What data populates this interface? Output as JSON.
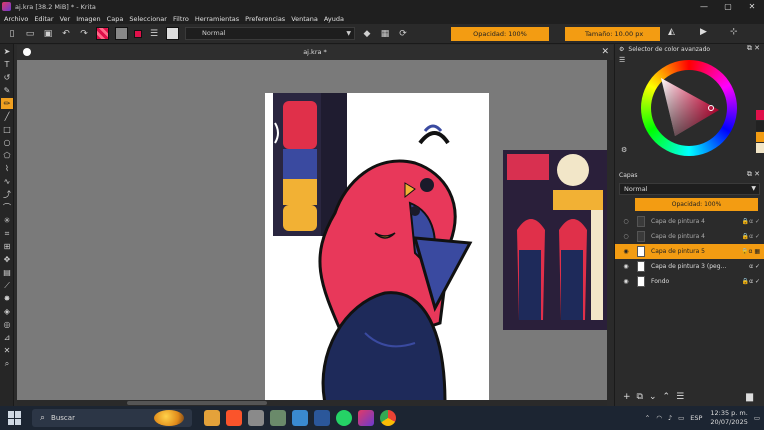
{
  "window": {
    "title": "aj.kra [38.2 MiB]  *  - Krita",
    "minimize": "—",
    "maximize": "▢",
    "close": "✕"
  },
  "menu": [
    "Archivo",
    "Editar",
    "Ver",
    "Imagen",
    "Capa",
    "Seleccionar",
    "Filtro",
    "Herramientas",
    "Preferencias",
    "Ventana",
    "Ayuda"
  ],
  "toolbar": {
    "blend_mode": "Normal",
    "opacity_label": "Opacidad: 100%",
    "size_label": "Tamaño: 10.00 px"
  },
  "document": {
    "tab_title": "aj.kra *",
    "close": "✕"
  },
  "panels": {
    "color_selector_title": "Selector de color avanzado",
    "layers_title": "Capas",
    "layers_blend": "Normal",
    "layers_opacity": "Opacidad: 100%",
    "layers": [
      {
        "name": "Capa de pintura 4",
        "visible": false,
        "selected": false
      },
      {
        "name": "Capa de pintura 4",
        "visible": false,
        "selected": false
      },
      {
        "name": "Capa de pintura 5",
        "visible": true,
        "selected": true
      },
      {
        "name": "Capa de pintura 3 (peg...",
        "visible": true,
        "selected": false
      },
      {
        "name": "Fondo",
        "visible": true,
        "selected": false
      }
    ],
    "eye_icon": "👁",
    "add": "+",
    "trash": "🗑"
  },
  "taskbar": {
    "search_placeholder": "Buscar",
    "lang": "ESP",
    "time": "12:35 p. m.",
    "date": "20/07/2025"
  },
  "colors": {
    "accent": "#f39c12",
    "foreground": "#e0104a",
    "background": "#ffffff"
  }
}
